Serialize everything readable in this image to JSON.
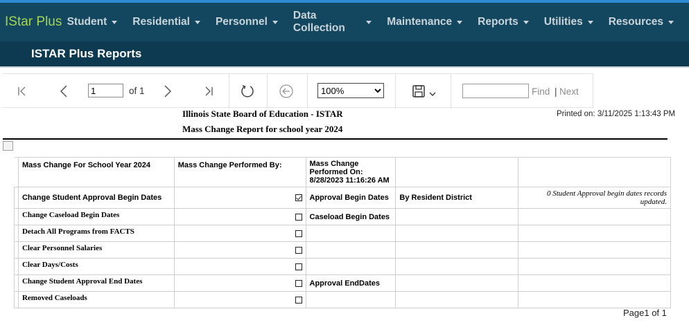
{
  "app": {
    "brand": "IStar Plus",
    "nav": [
      "Student",
      "Residential",
      "Personnel",
      "Data Collection",
      "Maintenance",
      "Reports",
      "Utilities",
      "Resources"
    ],
    "page_title": "ISTAR Plus Reports"
  },
  "toolbar": {
    "page_value": "1",
    "of_label": "of 1",
    "zoom_value": "100%",
    "zoom_options": [
      "100%"
    ],
    "find_label": "Find",
    "separator": "|",
    "next_label": "Next",
    "icons": [
      "first-page-icon",
      "prev-page-icon",
      "next-page-icon",
      "last-page-icon",
      "refresh-icon",
      "back-icon",
      "save-icon",
      "chevron-down-icon"
    ]
  },
  "report": {
    "title": "Illinois State Board of Education - ISTAR",
    "subtitle": "Mass Change Report for school year 2024",
    "printed_on": "Printed on: 3/11/2025 1:13:43 PM",
    "headers": {
      "col1": "Mass Change For School Year 2024",
      "col2": "Mass Change Performed By:",
      "col3": "Mass Change Performed On: 8/28/2023 11:16:26 AM"
    },
    "rows": [
      {
        "label": "Change Student Approval Begin Dates",
        "checked": true,
        "target": "Approval Begin Dates",
        "scope": "By Resident District",
        "note": "0 Student Approval begin dates records updated."
      },
      {
        "label": "Change Caseload Begin Dates",
        "checked": false,
        "target": "Caseload Begin Dates",
        "scope": "",
        "note": ""
      },
      {
        "label": "Detach All Programs from FACTS",
        "checked": false,
        "target": "",
        "scope": "",
        "note": ""
      },
      {
        "label": "Clear Personnel Salaries",
        "checked": false,
        "target": "",
        "scope": "",
        "note": ""
      },
      {
        "label": "Clear Days/Costs",
        "checked": false,
        "target": "",
        "scope": "",
        "note": ""
      },
      {
        "label": "Change Student Approval End Dates",
        "checked": false,
        "target": "Approval EndDates",
        "scope": "",
        "note": ""
      },
      {
        "label": "Removed Caseloads",
        "checked": false,
        "target": "",
        "scope": "",
        "note": ""
      }
    ],
    "page_footer": "Page1 of 1"
  },
  "colors": {
    "nav_bg": "#13475f",
    "subheader_bg": "#0d3a50",
    "brand": "#a6d651",
    "top_stripe": "#2e8bd3"
  }
}
